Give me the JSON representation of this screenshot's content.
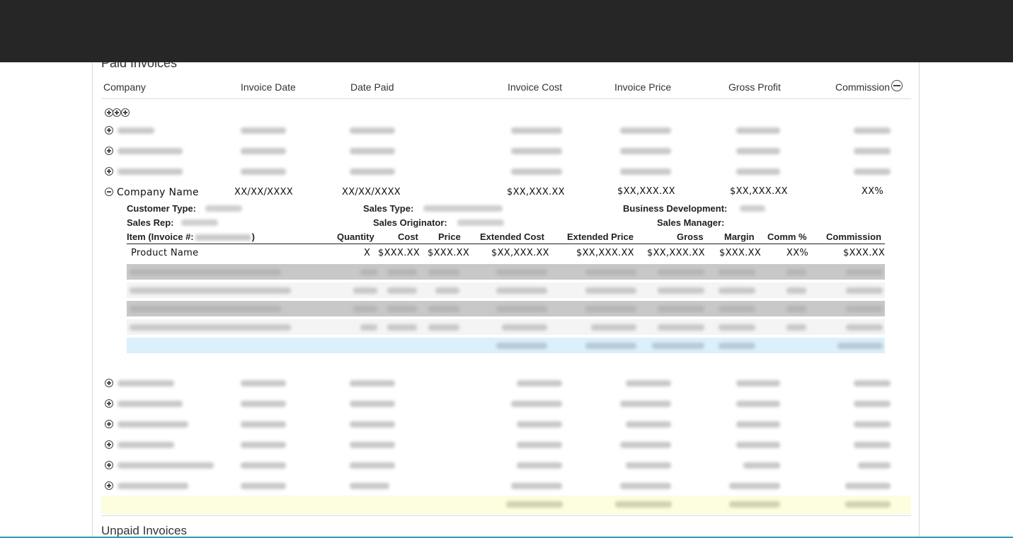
{
  "paid_section": {
    "title": "Paid Invoices"
  },
  "unpaid_section": {
    "title": "Unpaid Invoices"
  },
  "columns": {
    "company": "Company",
    "invoice_date": "Invoice Date",
    "date_paid": "Date Paid",
    "invoice_cost": "Invoice Cost",
    "invoice_price": "Invoice Price",
    "gross_profit": "Gross Profit",
    "commission": "Commission"
  },
  "expanded_row": {
    "company": "Company Name",
    "invoice_date": "XX/XX/XXXX",
    "date_paid": "XX/XX/XXXX",
    "invoice_cost": "$XX,XXX.XX",
    "invoice_price": "$XX,XXX.XX",
    "gross_profit": "$XX,XXX.XX",
    "commission": "XX%"
  },
  "detail": {
    "customer_type_label": "Customer Type:",
    "sales_type_label": "Sales Type:",
    "business_development_label": "Business Development:",
    "sales_rep_label": "Sales Rep:",
    "sales_originator_label": "Sales Originator:",
    "sales_manager_label": "Sales Manager:",
    "item_header_prefix": "Item (Invoice #:",
    "item_header_suffix": ")",
    "columns": {
      "quantity": "Quantity",
      "cost": "Cost",
      "price": "Price",
      "extended_cost": "Extended Cost",
      "extended_price": "Extended Price",
      "gross": "Gross",
      "margin": "Margin",
      "comm_pct": "Comm %",
      "commission": "Commission"
    },
    "first_item": {
      "name": "Product Name",
      "quantity": "X",
      "cost": "$XXX.XX",
      "price": "$XXX.XX",
      "extended_cost": "$XX,XXX.XX",
      "extended_price": "$XX,XXX.XX",
      "gross": "$XX,XXX.XX",
      "margin": "$XXX.XX",
      "comm_pct": "XX%",
      "commission": "$XXX.XX"
    }
  },
  "colors": {
    "top_bar": "#262626",
    "accent_line": "#2b9db5",
    "subtotal_band": "#dcf0fb",
    "grand_total_band": "#fdfde0",
    "shaded_item": "#c8c8c8"
  },
  "icons": {
    "expand": "plus-circle-icon",
    "collapse": "minus-circle-icon",
    "expand_all": "expand-all-icon"
  }
}
